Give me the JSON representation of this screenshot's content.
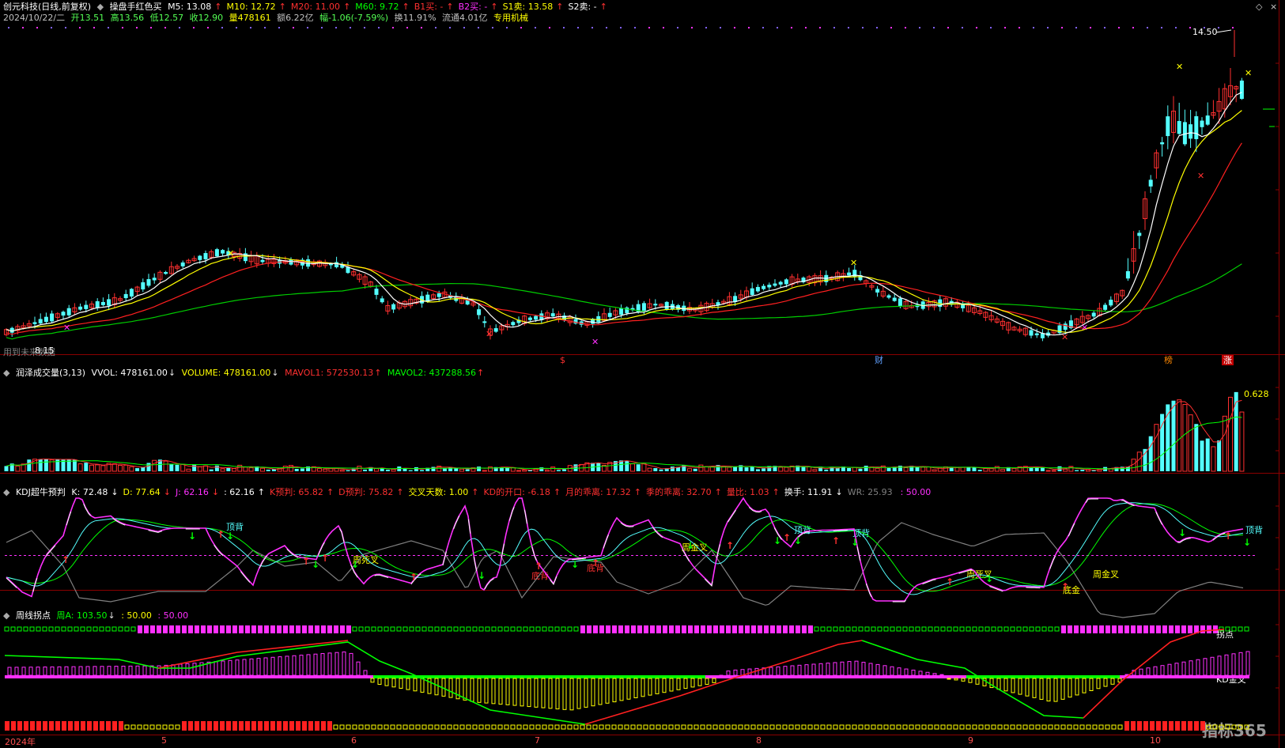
{
  "main_panel": {
    "title": "创元科技(日线,前复权)",
    "indicator": "操盘手红色买",
    "ma": [
      {
        "label": "M5:",
        "value": "13.08",
        "color": "#ffffff"
      },
      {
        "label": "M10:",
        "value": "12.72",
        "color": "#ffff00"
      },
      {
        "label": "M20:",
        "value": "11.00",
        "color": "#ff3030"
      },
      {
        "label": "M60:",
        "value": "9.72",
        "color": "#00ff00"
      },
      {
        "label": "B1买:",
        "value": "-",
        "color": "#ff3030"
      },
      {
        "label": "B2买:",
        "value": "-",
        "color": "#ff30ff"
      },
      {
        "label": "S1卖:",
        "value": "13.58",
        "color": "#ffff00"
      },
      {
        "label": "S2卖:",
        "value": "-",
        "color": "#ffffff"
      }
    ],
    "info_line": {
      "date": "2024/10/22/二",
      "open": "开13.51",
      "high": "高13.56",
      "low": "低12.57",
      "close": "收12.90",
      "volume": "量478161",
      "amount": "额6.22亿",
      "change": "幅-1.06(-7.59%)",
      "turnover": "换11.91%",
      "float": "流通4.01亿",
      "industry": "专用机械"
    },
    "price_marker": "14.50",
    "bottom_note": "用到未来数据",
    "low_marker": "8.15",
    "event_tags": [
      {
        "text": "$",
        "color": "#ff3030"
      },
      {
        "text": "财",
        "color": "#60a0ff"
      },
      {
        "text": "榜",
        "color": "#ff8800"
      },
      {
        "text": "涨",
        "color": "#ffffff"
      }
    ],
    "ma_colors": {
      "m5": "#ffffff",
      "m10": "#ffff00",
      "m20": "#ff2020",
      "m60": "#00cc00"
    },
    "up_color": "#ff3030",
    "down_color": "#54ffff"
  },
  "volume_panel": {
    "title": "润泽成交量(3,13)",
    "vvol": "VVOL: 478161.00",
    "volume": "VOLUME: 478161.00",
    "mavol1": "MAVOL1: 572530.13",
    "mavol2": "MAVOL2: 437288.56",
    "marker": "0.628"
  },
  "kdj_panel": {
    "title": "KDJ超牛预判",
    "values": [
      {
        "text": "K: 72.48",
        "color": "#ffffff"
      },
      {
        "text": "D: 77.64",
        "color": "#ffff00"
      },
      {
        "text": "J: 62.16",
        "color": "#ff30ff"
      },
      {
        "text": ": 62.16",
        "color": "#ffffff"
      },
      {
        "text": "K预判: 65.82",
        "color": "#ff3030"
      },
      {
        "text": "D预判: 75.82",
        "color": "#ff3030"
      },
      {
        "text": "交叉天数: 1.00",
        "color": "#ffff00"
      },
      {
        "text": "KD的开口: -6.18",
        "color": "#ff3030"
      },
      {
        "text": "月的乖离: 17.32",
        "color": "#ff3030"
      },
      {
        "text": "季的乖离: 32.70",
        "color": "#ff3030"
      },
      {
        "text": "量比: 1.03",
        "color": "#ff3030"
      },
      {
        "text": "换手: 11.91",
        "color": "#ffffff"
      },
      {
        "text": "WR: 25.93",
        "color": "#808080"
      },
      {
        "text": ": 50.00",
        "color": "#ff30ff"
      }
    ],
    "labels": [
      {
        "text": "顶背",
        "color": "#54ffff"
      },
      {
        "text": "周死叉",
        "color": "#ffff00"
      },
      {
        "text": "底背",
        "color": "#ff3030"
      },
      {
        "text": "底背",
        "color": "#ff3030"
      },
      {
        "text": "周金叉",
        "color": "#ffff00"
      },
      {
        "text": "顶背",
        "color": "#54ffff"
      },
      {
        "text": "顶背",
        "color": "#54ffff"
      },
      {
        "text": "周死叉",
        "color": "#ffff00"
      },
      {
        "text": "底金",
        "color": "#ffff00"
      },
      {
        "text": "周金叉",
        "color": "#ffff00"
      },
      {
        "text": "顶背",
        "color": "#54ffff"
      }
    ]
  },
  "weekly_panel": {
    "title": "周线拐点",
    "values": [
      {
        "text": "周A: 103.50",
        "color": "#00ff00"
      },
      {
        "text": ": 50.00",
        "color": "#ffff00"
      },
      {
        "text": ": 50.00",
        "color": "#ff30ff"
      }
    ],
    "labels": [
      {
        "text": "拐点",
        "color": "#ffffff"
      },
      {
        "text": "KD金叉",
        "color": "#ffffff"
      }
    ]
  },
  "x_axis": {
    "labels": [
      "2024年",
      "5",
      "6",
      "7",
      "8",
      "9",
      "10"
    ]
  },
  "watermark": "指标365"
}
